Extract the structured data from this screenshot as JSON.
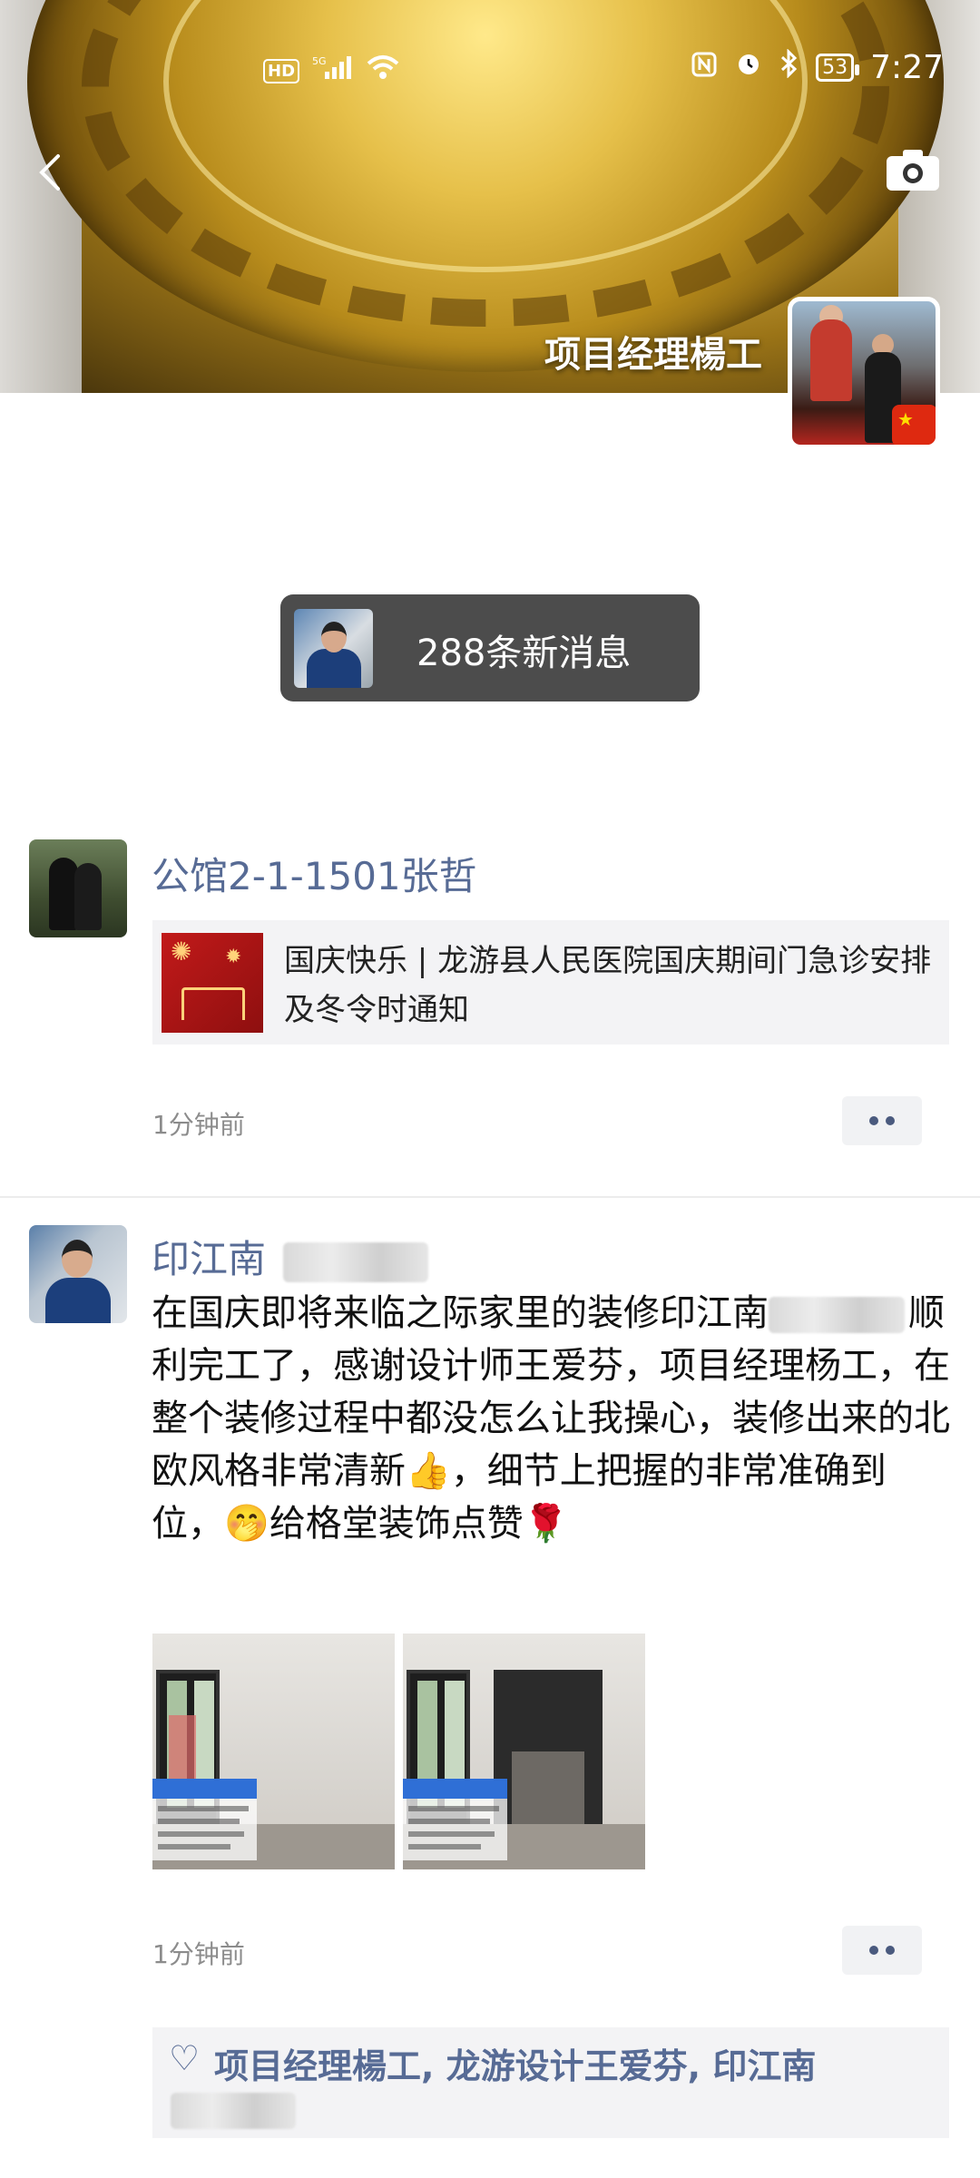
{
  "status_bar": {
    "left_chips": [
      "HD",
      "5G"
    ],
    "battery": "53",
    "time": "7:27"
  },
  "header": {
    "profile_name": "项目经理楊工",
    "back_icon": "chevron-left-icon",
    "camera_icon": "camera-icon"
  },
  "new_messages": {
    "label": "288条新消息"
  },
  "posts": [
    {
      "author": "公馆2-1-1501张哲",
      "share": {
        "title": "国庆快乐 | 龙游县人民医院国庆期间门急诊安排及冬令时通知"
      },
      "time": "1分钟前"
    },
    {
      "author": "印江南",
      "text_part1": "在国庆即将来临之际家里的装修印江南",
      "text_part2": "顺利完工了，感谢设计师王爱芬，项目经理杨工，在整个装修过程中都没怎么让我操心，装修出来的北欧风格非常清新",
      "emoji_thumbs": "👍",
      "text_part3": "，细节上把握的非常准确到位，",
      "emoji_face": "🤭",
      "text_part4": "给格堂装饰点赞",
      "emoji_rose": "🌹",
      "photos": [
        "room-photo-1",
        "room-photo-2"
      ],
      "time": "1分钟前",
      "likes": {
        "icon": "heart-icon",
        "names": "项目经理楊工, 龙游设计王爱芬, 印江南"
      }
    }
  ]
}
